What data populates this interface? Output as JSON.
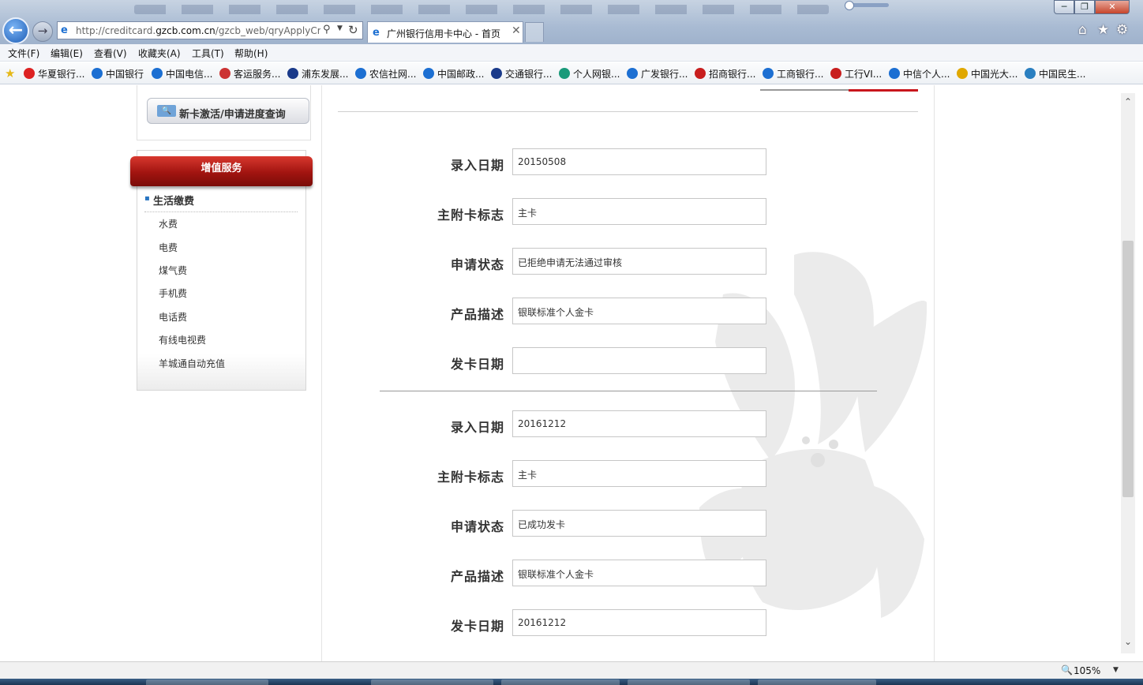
{
  "browser": {
    "url_prefix": "http://creditcard.",
    "url_domain": "gzcb.com.cn",
    "url_path": "/gzcb_web/qryApplyCre",
    "tab_title": "广州银行信用卡中心 - 首页",
    "tab_close": "✕",
    "zoom": "105%"
  },
  "menu": [
    "文件(F)",
    "编辑(E)",
    "查看(V)",
    "收藏夹(A)",
    "工具(T)",
    "帮助(H)"
  ],
  "favorites": [
    {
      "label": "华夏银行...",
      "color": "#d22"
    },
    {
      "label": "中国银行",
      "color": "#1c6fd2"
    },
    {
      "label": "中国电信...",
      "color": "#1c6fd2"
    },
    {
      "label": "客运服务...",
      "color": "#c33"
    },
    {
      "label": "浦东发展...",
      "color": "#1a3a8a"
    },
    {
      "label": "农信社网...",
      "color": "#1c6fd2"
    },
    {
      "label": "中国邮政...",
      "color": "#1c6fd2"
    },
    {
      "label": "交通银行...",
      "color": "#1a3a8a"
    },
    {
      "label": "个人网银...",
      "color": "#1a9a7a"
    },
    {
      "label": "广发银行...",
      "color": "#1c6fd2"
    },
    {
      "label": "招商银行...",
      "color": "#c81e1e"
    },
    {
      "label": "工商银行...",
      "color": "#1c6fd2"
    },
    {
      "label": "工行VI...",
      "color": "#c81e1e"
    },
    {
      "label": "中信个人...",
      "color": "#1c6fd2"
    },
    {
      "label": "中国光大...",
      "color": "#e0a800"
    },
    {
      "label": "中国民生...",
      "color": "#2a7fc0"
    }
  ],
  "sidebar": {
    "activate_button": "新卡激活/申请进度查询",
    "value_added_title": "增值服务",
    "category": "生活缴费",
    "items": [
      "水费",
      "电费",
      "煤气费",
      "手机费",
      "电话费",
      "有线电视费",
      "羊城通自动充值"
    ]
  },
  "records": [
    {
      "fields": [
        {
          "label": "录入日期",
          "value": "20150508"
        },
        {
          "label": "主附卡标志",
          "value": "主卡"
        },
        {
          "label": "申请状态",
          "value": "已拒绝申请无法通过审核"
        },
        {
          "label": "产品描述",
          "value": "银联标准个人金卡"
        },
        {
          "label": "发卡日期",
          "value": ""
        }
      ]
    },
    {
      "fields": [
        {
          "label": "录入日期",
          "value": "20161212"
        },
        {
          "label": "主附卡标志",
          "value": "主卡"
        },
        {
          "label": "申请状态",
          "value": "已成功发卡"
        },
        {
          "label": "产品描述",
          "value": "银联标准个人金卡"
        },
        {
          "label": "发卡日期",
          "value": "20161212"
        }
      ]
    }
  ],
  "colors": {
    "accent_red": "#c8161d",
    "link_blue": "#1c6fd2"
  }
}
